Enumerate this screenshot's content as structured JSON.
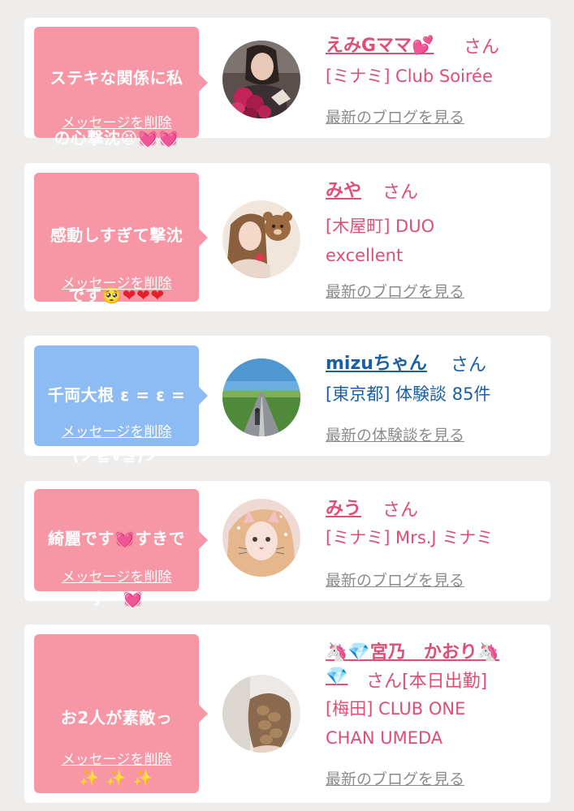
{
  "cards": [
    {
      "bubble_color": "#f796a5",
      "message": {
        "line1": "ステキな関係に私",
        "line2": "の心撃沈",
        "emoji1": "😫",
        "emoji2": "💓",
        "emoji3": "💓"
      },
      "delete_label": "メッセージを削除",
      "avatar_icon": "woman-with-flowers-photo",
      "name": "えみGママ",
      "name_emoji": "💕",
      "honorific": "さん",
      "location": "[ミナミ] Club Soirée",
      "link": "最新のブログを見る"
    },
    {
      "bubble_color": "#f796a5",
      "message": {
        "line1": "感動しすぎて撃沈",
        "line2": "です",
        "emoji1": "🥺",
        "emoji2": "❤",
        "emoji3": "❤",
        "emoji4": "❤"
      },
      "delete_label": "メッセージを削除",
      "avatar_icon": "woman-with-bear-sticker-photo",
      "name": "みや",
      "honorific": "さん",
      "location1": "[木屋町] DUO",
      "location2": "excellent",
      "link": "最新のブログを見る"
    },
    {
      "bubble_color": "#8dbbf4",
      "message": {
        "line1": "千両大根 ε = ε =",
        "line2": "(ノ≧∇≦)ノ"
      },
      "delete_label": "メッセージを削除",
      "avatar_icon": "road-landscape-photo",
      "name": "mizuちゃん",
      "honorific": "さん",
      "location": "[東京都] 体験談 85件",
      "link": "最新の体験談を見る"
    },
    {
      "bubble_color": "#f796a5",
      "message": {
        "line1a": "綺麗です",
        "emoji1": "💓",
        "line1b": "すきで",
        "line2": "すー",
        "emoji2": "💓"
      },
      "delete_label": "メッセージを削除",
      "avatar_icon": "woman-with-cat-filter-photo",
      "name": "みう",
      "honorific": "さん",
      "location": "[ミナミ] Mrs.J ミナミ",
      "link": "最新のブログを見る"
    },
    {
      "bubble_color": "#f796a5",
      "message": {
        "line1": "お2人が素敵っ",
        "emoji1": "✨",
        "emoji2": "✨",
        "emoji3": "✨"
      },
      "delete_label": "メッセージを削除",
      "avatar_icon": "braided-hair-photo",
      "name_prefix_emoji1": "🦄",
      "name_prefix_emoji2": "💎",
      "name": "宮乃　かおり",
      "name_suffix_emoji1": "🦄",
      "name_suffix_emoji2": "💎",
      "honorific": "さん[本日出勤]",
      "location1": "[梅田] CLUB ONE",
      "location2": "CHAN UMEDA",
      "link": "最新のブログを見る"
    }
  ]
}
